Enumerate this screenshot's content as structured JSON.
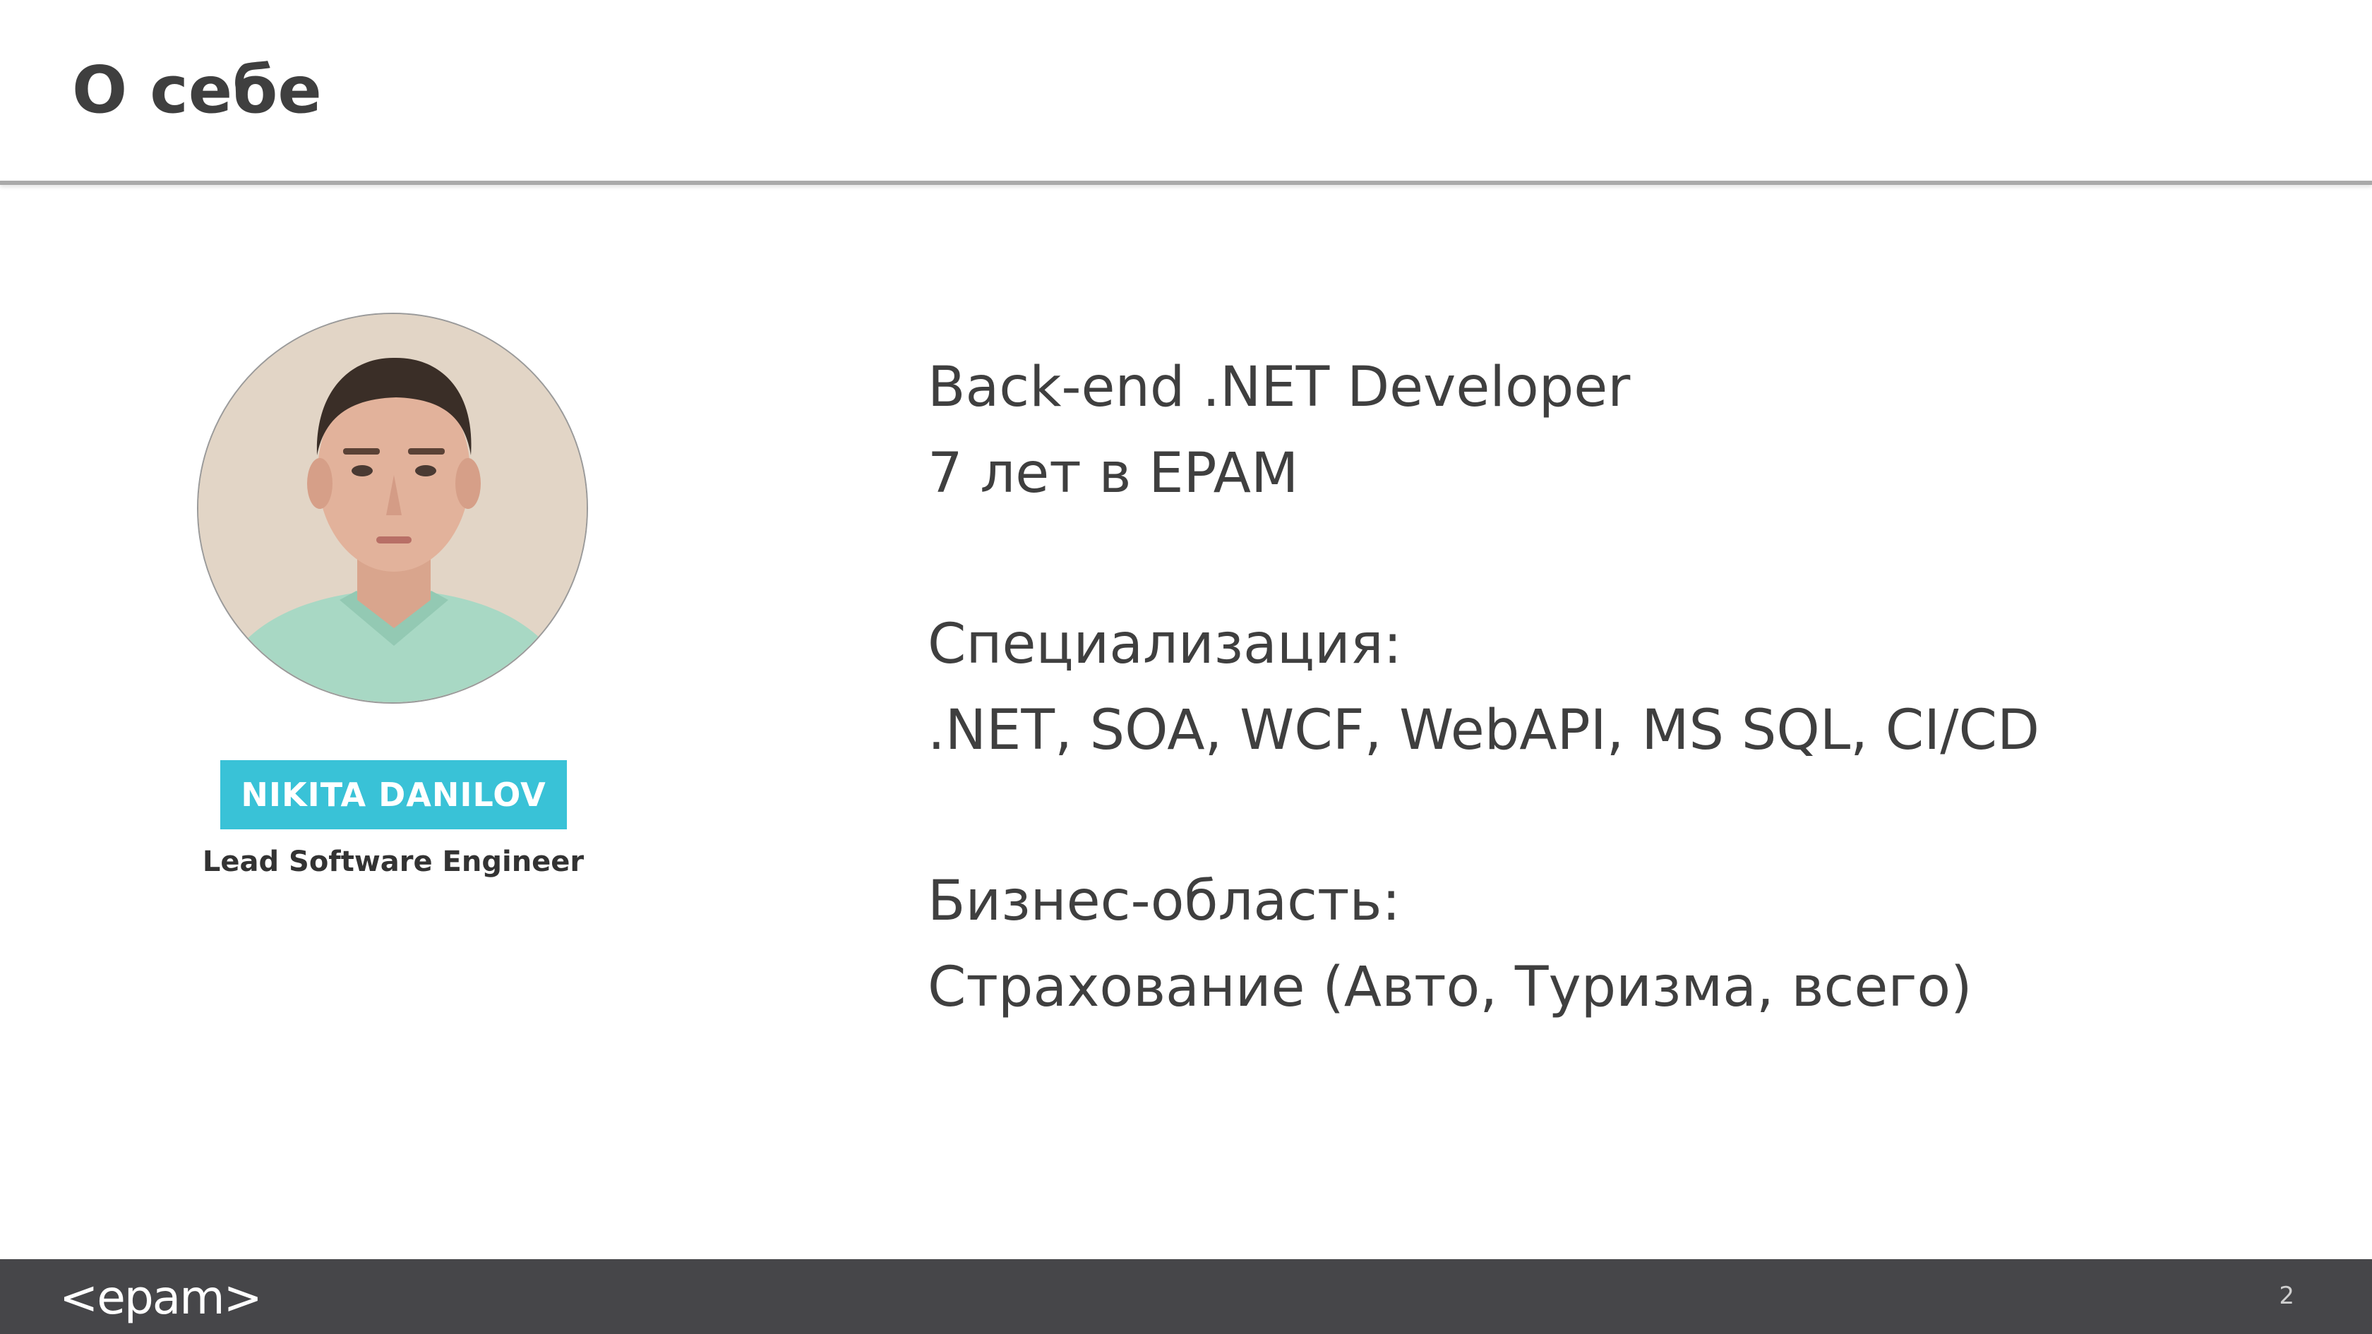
{
  "header": {
    "title": "О себе"
  },
  "profile": {
    "name": "NIKITA DANILOV",
    "role": "Lead Software Engineer",
    "badge_color": "#39c2d7"
  },
  "content": {
    "line1": "Back-end .NET Developer",
    "line2": "7 лет в EPAM",
    "specialization_label": "Специализация:",
    "specialization_value": ".NET, SOA, WCF, WebAPI, MS SQL, CI/CD",
    "business_label": "Бизнес-область:",
    "business_value": "Страхование (Авто, Туризма, всего)"
  },
  "footer": {
    "logo": "<epam>",
    "page_number": "2",
    "background": "#464649"
  }
}
